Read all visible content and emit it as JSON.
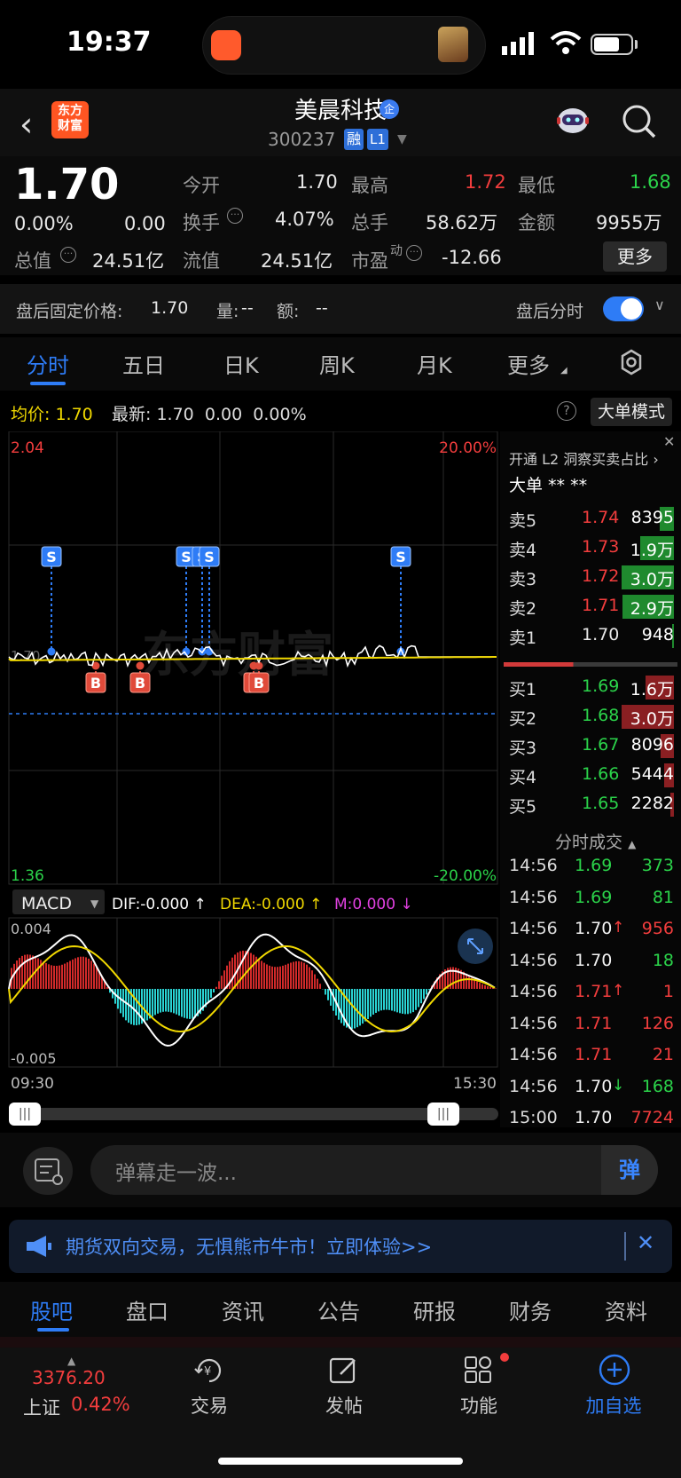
{
  "status": {
    "time": "19:37"
  },
  "header": {
    "logo_line1": "东方",
    "logo_line2": "财富",
    "stock_name": "美晨科技",
    "qi_badge": "企",
    "stock_code": "300237",
    "badge_rong": "融",
    "badge_l1": "L1"
  },
  "quote": {
    "price": "1.70",
    "change_pct": "0.00%",
    "change_abs": "0.00",
    "open_label": "今开",
    "open": "1.70",
    "high_label": "最高",
    "high": "1.72",
    "low_label": "最低",
    "low": "1.68",
    "turnover_label": "换手",
    "turnover": "4.07%",
    "volume_label": "总手",
    "volume": "58.62万",
    "amount_label": "金额",
    "amount": "9955万",
    "mktcap_label": "总值",
    "mktcap": "24.51亿",
    "float_label": "流值",
    "float": "24.51亿",
    "pe_label": "市盈",
    "pe_sup": "动",
    "pe": "-12.66",
    "more": "更多"
  },
  "after_hours": {
    "fixed_price_label": "盘后固定价格:",
    "fixed_price": "1.70",
    "qty_label": "量:",
    "qty": "--",
    "amt_label": "额:",
    "amt": "--",
    "intraday_label": "盘后分时"
  },
  "chart_tabs": [
    "分时",
    "五日",
    "日K",
    "周K",
    "月K",
    "更多"
  ],
  "info": {
    "avg_label": "均价:",
    "avg": "1.70",
    "last_label": "最新:",
    "last": "1.70",
    "last_chg": "0.00",
    "last_pct": "0.00%",
    "big_order_mode": "大单模式"
  },
  "chart_labels": {
    "y_top": "2.04",
    "y_bottom": "1.36",
    "pct_top": "20.00%",
    "pct_bottom": "-20.00%",
    "baseline": "1.70",
    "macd_selector": "MACD",
    "dif": "DIF:-0.000 ↑",
    "dea": "DEA:-0.000 ↑",
    "m": "M:0.000 ↓",
    "macd_top": "0.004",
    "macd_bottom": "-0.005",
    "time_start": "09:30",
    "time_end": "15:30",
    "sell_marker": "S",
    "buy_marker": "B",
    "watermark": "东方财富"
  },
  "colors": {
    "up": "#f23d3d",
    "down": "#2bd34a",
    "accent": "#2e7cf6",
    "avg_line": "#f0d800"
  },
  "order_book": {
    "ad": "开通 L2 洞察买卖占比 ›",
    "dadan": "大单  **    **",
    "asks": [
      {
        "label": "卖5",
        "price": "1.74",
        "vol": "8395",
        "bar": 0.18
      },
      {
        "label": "卖4",
        "price": "1.73",
        "vol": "1.9万",
        "bar": 0.42
      },
      {
        "label": "卖3",
        "price": "1.72",
        "vol": "3.0万",
        "bar": 0.66
      },
      {
        "label": "卖2",
        "price": "1.71",
        "vol": "2.9万",
        "bar": 0.64
      },
      {
        "label": "卖1",
        "price": "1.70",
        "vol": "948",
        "bar": 0.02
      }
    ],
    "bids": [
      {
        "label": "买1",
        "price": "1.69",
        "vol": "1.6万",
        "bar": 0.36
      },
      {
        "label": "买2",
        "price": "1.68",
        "vol": "3.0万",
        "bar": 0.66
      },
      {
        "label": "买3",
        "price": "1.67",
        "vol": "8096",
        "bar": 0.17
      },
      {
        "label": "买4",
        "price": "1.66",
        "vol": "5444",
        "bar": 0.12
      },
      {
        "label": "买5",
        "price": "1.65",
        "vol": "2282",
        "bar": 0.05
      }
    ],
    "ticks_title": "分时成交",
    "ticks": [
      {
        "t": "14:56",
        "p": "1.69",
        "arrow": "",
        "v": "373",
        "c": "green"
      },
      {
        "t": "14:56",
        "p": "1.69",
        "arrow": "",
        "v": "81",
        "c": "green"
      },
      {
        "t": "14:56",
        "p": "1.70",
        "arrow": "↑",
        "v": "956",
        "c": "red"
      },
      {
        "t": "14:56",
        "p": "1.70",
        "arrow": "",
        "v": "18",
        "c": "green"
      },
      {
        "t": "14:56",
        "p": "1.71",
        "arrow": "↑",
        "v": "1",
        "c": "red"
      },
      {
        "t": "14:56",
        "p": "1.71",
        "arrow": "",
        "v": "126",
        "c": "red"
      },
      {
        "t": "14:56",
        "p": "1.71",
        "arrow": "",
        "v": "21",
        "c": "red"
      },
      {
        "t": "14:56",
        "p": "1.70",
        "arrow": "↓",
        "v": "168",
        "c": "green"
      },
      {
        "t": "15:00",
        "p": "1.70",
        "arrow": "",
        "v": "7724",
        "c": "red"
      }
    ]
  },
  "danmu": {
    "placeholder": "弹幕走一波...",
    "send": "弹"
  },
  "promo": {
    "text": "期货双向交易，无惧熊市牛市！立即体验>>"
  },
  "bottom_tabs": [
    "股吧",
    "盘口",
    "资讯",
    "公告",
    "研报",
    "财务",
    "资料"
  ],
  "nav": {
    "index_value": "3376.20",
    "index_name": "上证",
    "index_change": "0.42%",
    "items": [
      "交易",
      "发帖",
      "功能",
      "加自选"
    ]
  }
}
